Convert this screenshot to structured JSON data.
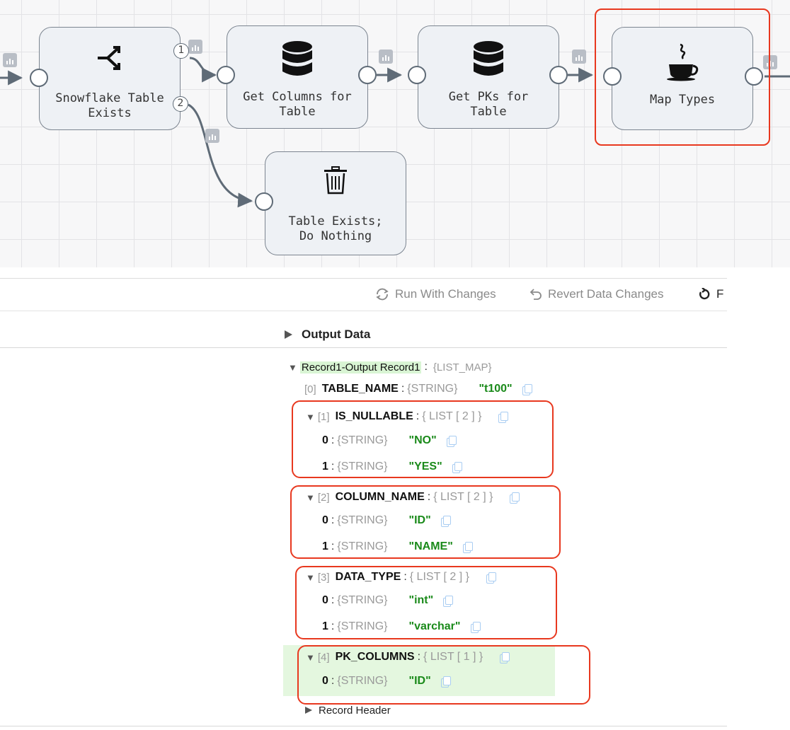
{
  "pipeline": {
    "stages": [
      {
        "id": "snowflake-table-exists",
        "label": "Snowflake Table\nExists",
        "icon": "stream-selector-icon"
      },
      {
        "id": "get-columns",
        "label": "Get Columns for\nTable",
        "icon": "database-icon"
      },
      {
        "id": "get-pks",
        "label": "Get PKs for\nTable",
        "icon": "database-icon"
      },
      {
        "id": "map-types",
        "label": "Map Types",
        "icon": "java-script-icon"
      },
      {
        "id": "table-exists",
        "label": "Table Exists;\nDo Nothing",
        "icon": "trash-icon"
      }
    ],
    "output_ports": [
      "1",
      "2"
    ],
    "selected_stage": "map-types"
  },
  "toolbar": {
    "run_with_changes": "Run With Changes",
    "revert_data_changes": "Revert Data Changes",
    "truncated_label": "F"
  },
  "output": {
    "title": "Output Data",
    "record": {
      "label": "Record1-Output Record1",
      "type": "{LIST_MAP}"
    },
    "fields": [
      {
        "index": "[0]",
        "name": "TABLE_NAME",
        "type": "{STRING}",
        "value": "\"t100\""
      },
      {
        "index": "[1]",
        "name": "IS_NULLABLE",
        "type": "{ LIST [ 2 ] }",
        "items": [
          {
            "index": "0",
            "type": "{STRING}",
            "value": "\"NO\""
          },
          {
            "index": "1",
            "type": "{STRING}",
            "value": "\"YES\""
          }
        ]
      },
      {
        "index": "[2]",
        "name": "COLUMN_NAME",
        "type": "{ LIST [ 2 ] }",
        "items": [
          {
            "index": "0",
            "type": "{STRING}",
            "value": "\"ID\""
          },
          {
            "index": "1",
            "type": "{STRING}",
            "value": "\"NAME\""
          }
        ]
      },
      {
        "index": "[3]",
        "name": "DATA_TYPE",
        "type": "{ LIST [ 2 ] }",
        "items": [
          {
            "index": "0",
            "type": "{STRING}",
            "value": "\"int\""
          },
          {
            "index": "1",
            "type": "{STRING}",
            "value": "\"varchar\""
          }
        ]
      },
      {
        "index": "[4]",
        "name": "PK_COLUMNS",
        "type": "{ LIST [ 1 ] }",
        "items": [
          {
            "index": "0",
            "type": "{STRING}",
            "value": "\"ID\""
          }
        ]
      }
    ],
    "record_header": "Record Header"
  },
  "colors": {
    "highlight": "#e8381f",
    "value_green": "#1a8a1a",
    "record_label_bg": "#d9f5d4"
  }
}
